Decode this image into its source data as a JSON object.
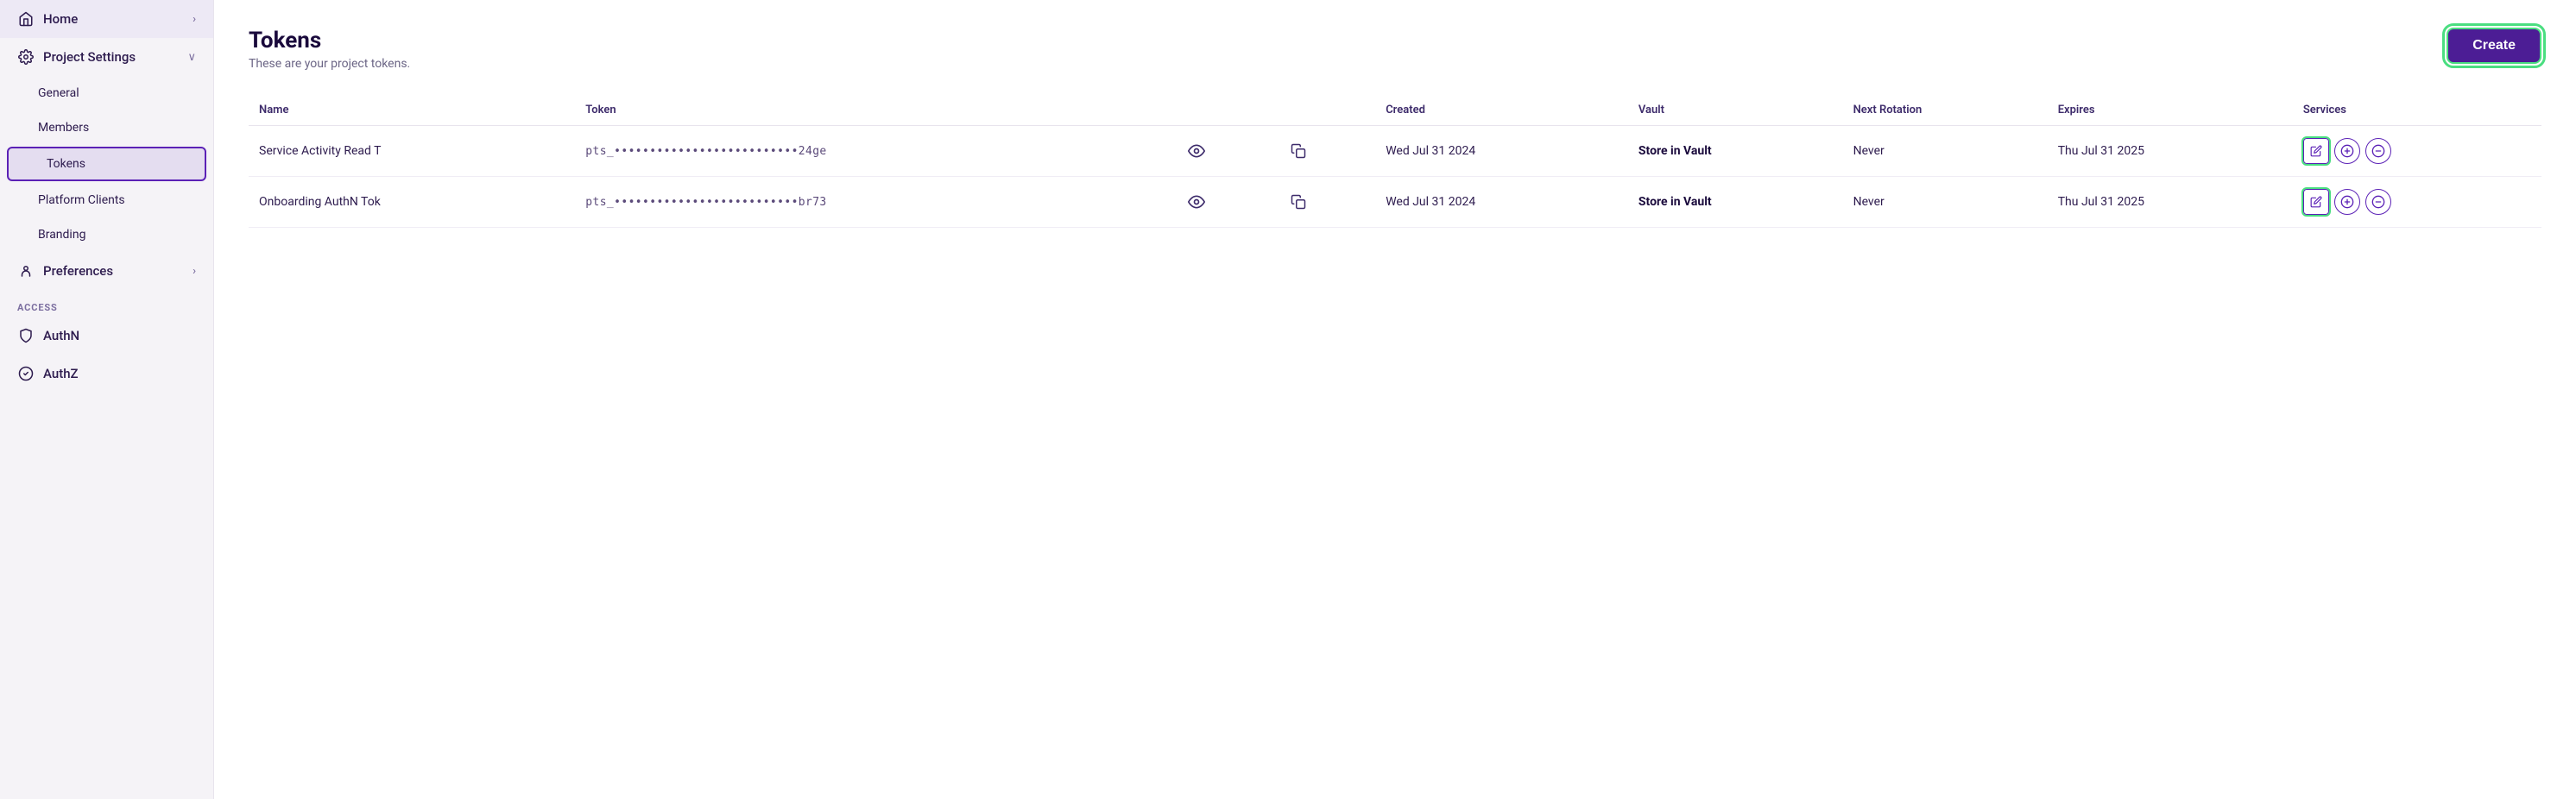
{
  "sidebar": {
    "home_label": "Home",
    "project_settings_label": "Project Settings",
    "general_label": "General",
    "members_label": "Members",
    "tokens_label": "Tokens",
    "platform_clients_label": "Platform Clients",
    "branding_label": "Branding",
    "preferences_label": "Preferences",
    "access_section": "ACCESS",
    "authn_label": "AuthN",
    "authz_label": "AuthZ"
  },
  "page": {
    "title": "Tokens",
    "subtitle": "These are your project tokens.",
    "create_button": "Create"
  },
  "table": {
    "columns": [
      "Name",
      "Token",
      "",
      "",
      "Created",
      "Vault",
      "Next Rotation",
      "Expires",
      "Services"
    ],
    "rows": [
      {
        "name": "Service Activity Read T",
        "token": "pts_••••••••••••••••••••••••••24ge",
        "created": "Wed Jul 31 2024",
        "vault": "Store in Vault",
        "next_rotation": "Never",
        "expires": "Thu Jul 31 2025",
        "services": ""
      },
      {
        "name": "Onboarding AuthN Tok",
        "token": "pts_••••••••••••••••••••••••••br73",
        "created": "Wed Jul 31 2024",
        "vault": "Store in Vault",
        "next_rotation": "Never",
        "expires": "Thu Jul 31 2025",
        "services": ""
      }
    ]
  }
}
